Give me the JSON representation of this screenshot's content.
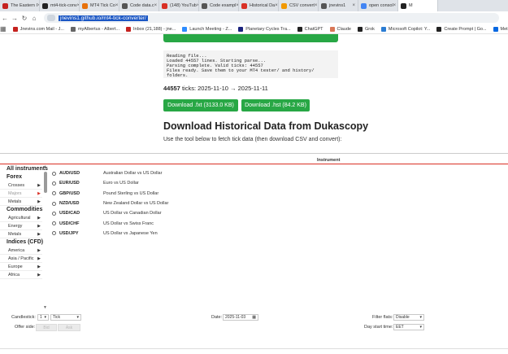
{
  "tabs": [
    {
      "title": "The Eastern I",
      "color": "#c5221f"
    },
    {
      "title": "mt4-tick-conv",
      "color": "#222222"
    },
    {
      "title": "MT4 Tick Co",
      "color": "#e8710a"
    },
    {
      "title": "Code data.c",
      "color": "#555555"
    },
    {
      "title": "(148) YouTub",
      "color": "#d93025"
    },
    {
      "title": "Code exampl",
      "color": "#555555"
    },
    {
      "title": "Historical Da",
      "color": "#d93025"
    },
    {
      "title": "CSV convert",
      "color": "#f29900"
    },
    {
      "title": "jnevins1",
      "color": "#555555"
    },
    {
      "title": "open consol",
      "color": "#4285f4"
    },
    {
      "title": "M",
      "color": "#222222"
    }
  ],
  "url": "jnevins1.github.io/mt4-tick-converter/",
  "bookmarks": [
    {
      "label": "Jnevins.com Mail - J...",
      "color": "#c5221f"
    },
    {
      "label": "myAlbertus - Albert...",
      "color": "#666666"
    },
    {
      "label": "Inbox (21,188) - jne...",
      "color": "#c5221f"
    },
    {
      "label": "Launch Meeting - Z...",
      "color": "#2d8cff"
    },
    {
      "label": "Planetary Cycles Tra...",
      "color": "#1a237e"
    },
    {
      "label": "ChatGPT",
      "color": "#222222"
    },
    {
      "label": "Claude",
      "color": "#d97757"
    },
    {
      "label": "Grok",
      "color": "#222222"
    },
    {
      "label": "Microsoft Copilot: Y...",
      "color": "#2b7cd3"
    },
    {
      "label": "Create Prompt | Go...",
      "color": "#222222"
    },
    {
      "label": "Meta AI",
      "color": "#0668e1"
    }
  ],
  "log": {
    "lines": [
      "Reading file...",
      "Loaded 44557 lines. Starting parse...",
      "Parsing complete. Valid ticks: 44557",
      "Files ready. Save them to your MT4 tester/ and history/ folders."
    ]
  },
  "summary": {
    "count": "44557",
    "text": "ticks: 2025-11-10 → 2025-11-11"
  },
  "downloads": {
    "fxt_label": "Download .fxt (3133.0 KB)",
    "hst_label": "Download .hst (84.2 KB)"
  },
  "section": {
    "heading": "Download Historical Data from Dukascopy",
    "subtext": "Use the tool below to fetch tick data (then download CSV and convert):"
  },
  "widget": {
    "instrument_header": "Instrument",
    "sidebar": [
      {
        "type": "head",
        "label": "All instruments"
      },
      {
        "type": "head",
        "label": "Forex"
      },
      {
        "type": "item",
        "label": "Crosses"
      },
      {
        "type": "item",
        "label": "Majors",
        "dim": true
      },
      {
        "type": "item",
        "label": "Metals"
      },
      {
        "type": "head",
        "label": "Commodities"
      },
      {
        "type": "item",
        "label": "Agricultural"
      },
      {
        "type": "item",
        "label": "Energy"
      },
      {
        "type": "item",
        "label": "Metals"
      },
      {
        "type": "head",
        "label": "Indices (CFD)"
      },
      {
        "type": "item",
        "label": "America"
      },
      {
        "type": "item",
        "label": "Asia / Pacific"
      },
      {
        "type": "item",
        "label": "Europe"
      },
      {
        "type": "item",
        "label": "Africa"
      }
    ],
    "pairs": [
      {
        "symbol": "AUD/USD",
        "name": "Australian Dollar vs US Dollar"
      },
      {
        "symbol": "EUR/USD",
        "name": "Euro vs US Dollar"
      },
      {
        "symbol": "GBP/USD",
        "name": "Pound Sterling vs US Dollar"
      },
      {
        "symbol": "NZD/USD",
        "name": "New Zealand Dollar vs US Dollar"
      },
      {
        "symbol": "USD/CAD",
        "name": "US Dollar vs Canadian Dollar"
      },
      {
        "symbol": "USD/CHF",
        "name": "US Dollar vs Swiss Franc"
      },
      {
        "symbol": "USD/JPY",
        "name": "US Dollar vs Japanese Yen"
      }
    ],
    "candlestick_label": "Candlestick:",
    "candlestick_value": "1",
    "candlestick_unit": "Tick",
    "offer_side_label": "Offer side:",
    "bid_label": "Bid",
    "ask_label": "Ask",
    "date_label": "Date:",
    "date_value": "2025-11-03",
    "filter_label": "Filter flats:",
    "filter_value": "Disable",
    "daystart_label": "Day start time:",
    "daystart_value": "EET"
  },
  "colors": {
    "accent_green": "#28a745",
    "divider_red": "#d93025"
  }
}
